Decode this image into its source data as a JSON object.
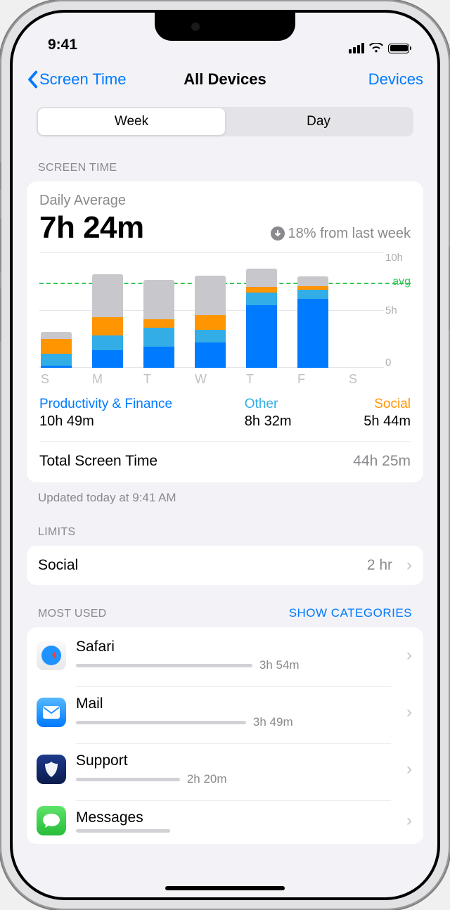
{
  "status": {
    "time": "9:41"
  },
  "nav": {
    "back": "Screen Time",
    "title": "All Devices",
    "right": "Devices"
  },
  "segmented": {
    "week": "Week",
    "day": "Day"
  },
  "sections": {
    "screen_time": "SCREEN TIME",
    "limits": "LIMITS",
    "most_used": "MOST USED",
    "show_categories": "SHOW CATEGORIES"
  },
  "daily": {
    "label": "Daily Average",
    "value": "7h 24m",
    "change": "18% from last week"
  },
  "chart_data": {
    "type": "bar",
    "categories": [
      "S",
      "M",
      "T",
      "W",
      "T",
      "F",
      "S"
    ],
    "ylim": [
      0,
      10
    ],
    "unit": "hours",
    "avg": 7.4,
    "yticks": [
      "10h",
      "5h",
      "0"
    ],
    "avg_label": "avg",
    "series_colors": {
      "blue": "#007aff",
      "teal": "#32ade6",
      "orange": "#ff9500",
      "gray": "#c7c7cc"
    },
    "stacks": [
      {
        "blue": 0.2,
        "teal": 1.0,
        "orange": 1.3,
        "gray": 0.6
      },
      {
        "blue": 1.5,
        "teal": 1.3,
        "orange": 1.6,
        "gray": 3.7
      },
      {
        "blue": 1.8,
        "teal": 1.7,
        "orange": 0.7,
        "gray": 3.4
      },
      {
        "blue": 2.2,
        "teal": 1.1,
        "orange": 1.3,
        "gray": 3.4
      },
      {
        "blue": 5.4,
        "teal": 1.1,
        "orange": 0.5,
        "gray": 1.6
      },
      {
        "blue": 6.0,
        "teal": 0.8,
        "orange": 0.3,
        "gray": 0.8
      },
      {
        "blue": 0,
        "teal": 0,
        "orange": 0,
        "gray": 0
      }
    ]
  },
  "categories": {
    "pf": {
      "name": "Productivity & Finance",
      "value": "10h 49m"
    },
    "other": {
      "name": "Other",
      "value": "8h 32m"
    },
    "social": {
      "name": "Social",
      "value": "5h 44m"
    }
  },
  "total": {
    "label": "Total Screen Time",
    "value": "44h 25m"
  },
  "updated": "Updated today at 9:41 AM",
  "limits": [
    {
      "name": "Social",
      "value": "2 hr"
    }
  ],
  "most_used": [
    {
      "name": "Safari",
      "time": "3h 54m",
      "width": 56,
      "icon": "safari"
    },
    {
      "name": "Mail",
      "time": "3h 49m",
      "width": 54,
      "icon": "mail"
    },
    {
      "name": "Support",
      "time": "2h 20m",
      "width": 33,
      "icon": "support"
    },
    {
      "name": "Messages",
      "time": "",
      "width": 30,
      "icon": "messages"
    }
  ]
}
